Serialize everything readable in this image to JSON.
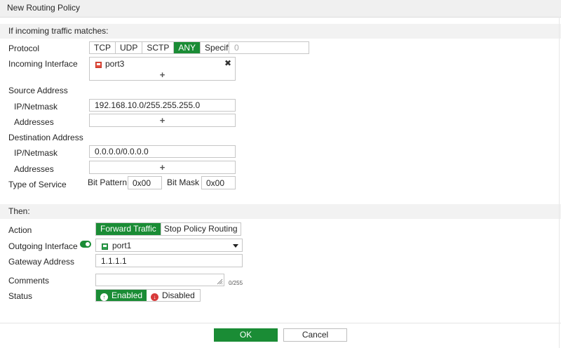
{
  "title": "New Routing Policy",
  "match_section": {
    "heading": "If incoming traffic matches:"
  },
  "protocol": {
    "label": "Protocol",
    "options": [
      "TCP",
      "UDP",
      "SCTP",
      "ANY",
      "Specify"
    ],
    "selected": "ANY",
    "number_placeholder": "0"
  },
  "incoming_interface": {
    "label": "Incoming Interface",
    "value": "port3",
    "remove_glyph": "✖",
    "add_glyph": "+"
  },
  "source": {
    "heading": "Source Address",
    "ip_label": "IP/Netmask",
    "ip_value": "192.168.10.0/255.255.255.0",
    "addresses_label": "Addresses",
    "add_glyph": "+"
  },
  "destination": {
    "heading": "Destination Address",
    "ip_label": "IP/Netmask",
    "ip_value": "0.0.0.0/0.0.0.0",
    "addresses_label": "Addresses",
    "add_glyph": "+"
  },
  "tos": {
    "label": "Type of Service",
    "bit_pattern_label": "Bit Pattern",
    "bit_pattern_value": "0x00",
    "bit_mask_label": "Bit Mask",
    "bit_mask_value": "0x00"
  },
  "then_section": {
    "heading": "Then:"
  },
  "action": {
    "label": "Action",
    "options": [
      "Forward Traffic",
      "Stop Policy Routing"
    ],
    "selected": "Forward Traffic"
  },
  "outgoing_interface": {
    "label": "Outgoing Interface",
    "toggle_on": true,
    "value": "port1"
  },
  "gateway": {
    "label": "Gateway Address",
    "value": "1.1.1.1"
  },
  "comments": {
    "label": "Comments",
    "value": "",
    "counter": "0/255"
  },
  "status": {
    "label": "Status",
    "enabled_label": "Enabled",
    "disabled_label": "Disabled",
    "selected": "Enabled"
  },
  "footer": {
    "ok_label": "OK",
    "cancel_label": "Cancel"
  },
  "colors": {
    "accent": "#1a8c35",
    "section_bg": "#f2f2f2",
    "border": "#c6c6c6",
    "disabled_icon": "#d83b3b"
  }
}
